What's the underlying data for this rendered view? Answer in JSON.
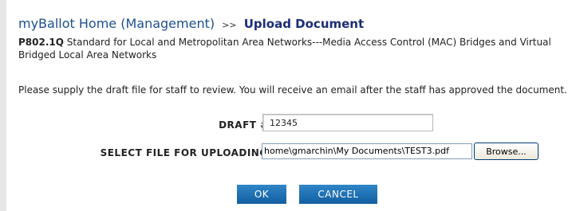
{
  "header": {
    "home_link": "myBallot Home (Management)",
    "separator": ">>",
    "page_title": "Upload Document"
  },
  "project": {
    "id": "P802.1Q",
    "title": "Standard for Local and Metropolitan Area Networks---Media Access Control (MAC) Bridges and Virtual Bridged Local Area Networks"
  },
  "instructions": "Please supply the draft file for staff to review. You will receive an email after the staff has approved the document.",
  "form": {
    "draft_label": "DRAFT #:",
    "draft_value": "12345",
    "file_label": "SELECT FILE FOR UPLOADING:",
    "file_value": "home\\gmarchin\\My Documents\\TEST3.pdf",
    "browse_label": "Browse..."
  },
  "buttons": {
    "ok_label": "OK",
    "cancel_label": "CANCEL"
  }
}
